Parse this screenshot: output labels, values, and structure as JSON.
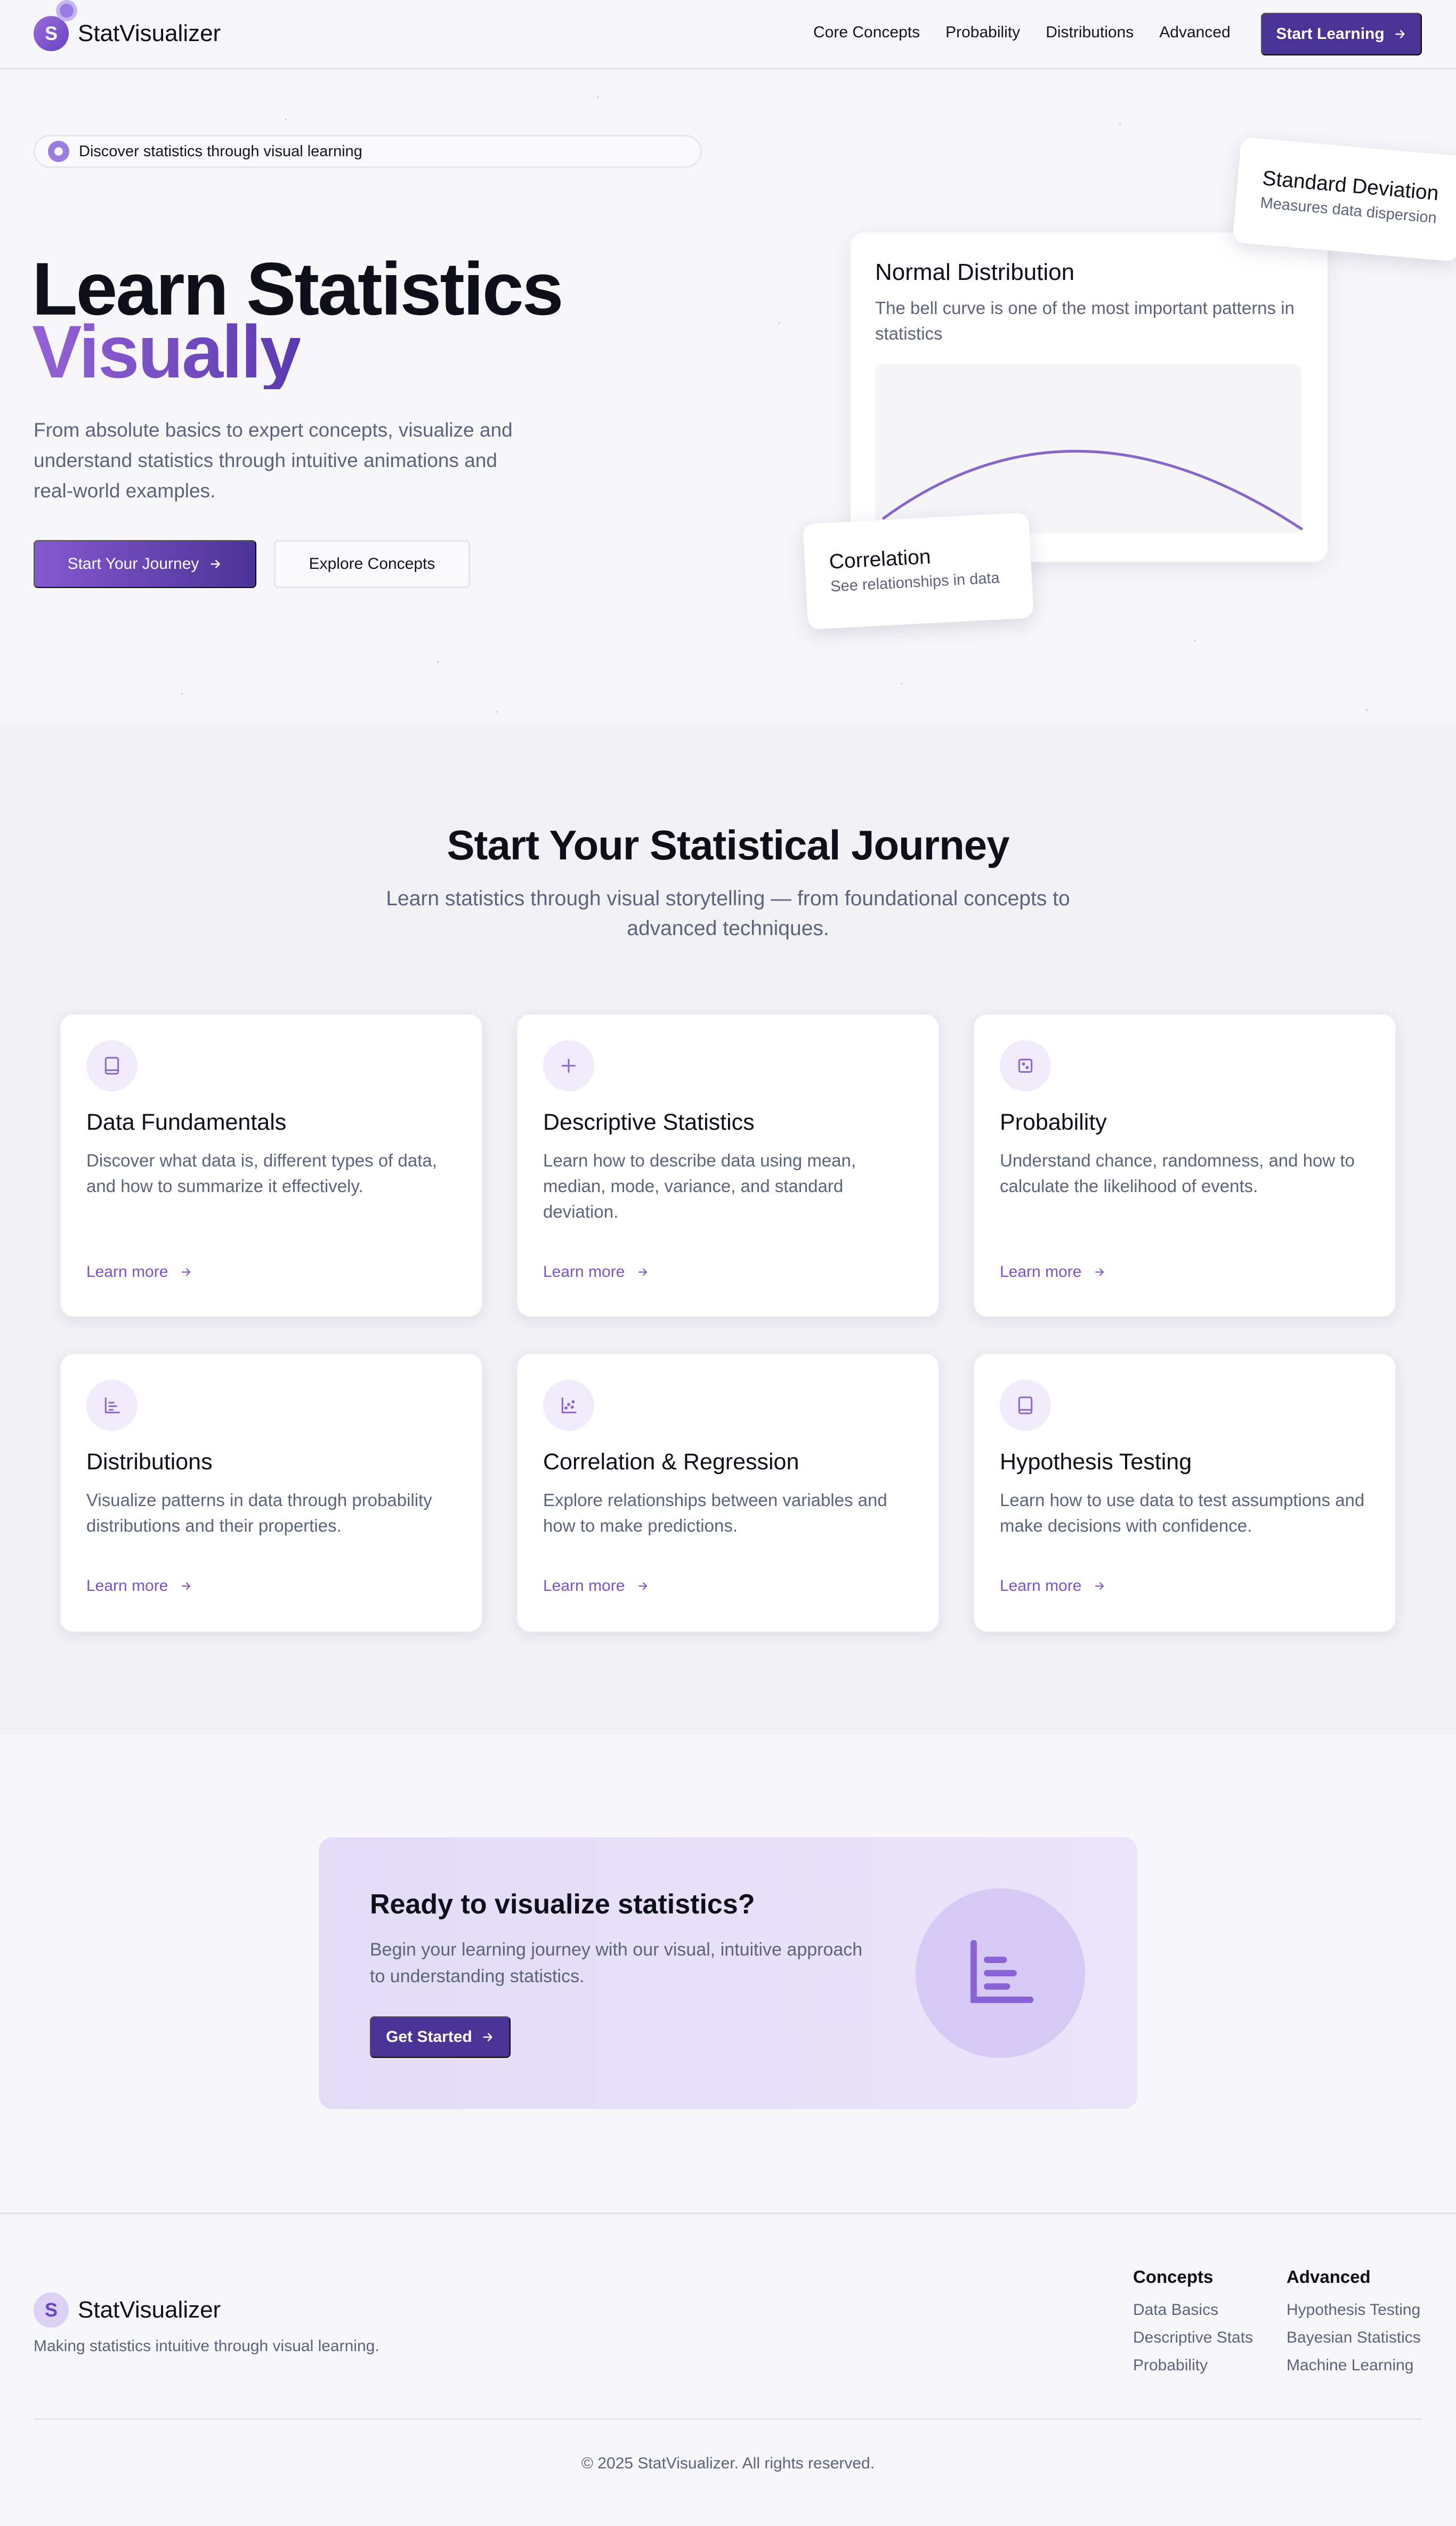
{
  "nav": {
    "logo_letter": "S",
    "brand": "StatVisualizer",
    "links": [
      "Core Concepts",
      "Probability",
      "Distributions",
      "Advanced"
    ],
    "cta_label": "Start Learning"
  },
  "hero": {
    "pill_text": "Discover statistics through visual learning",
    "title_line1": "Learn Statistics",
    "title_line2": "Visually",
    "paragraph": "From absolute basics to expert concepts, visualize and understand statistics through intuitive animations and real-world examples.",
    "primary_button": "Start Your Journey",
    "secondary_button": "Explore Concepts",
    "normal_card": {
      "title": "Normal Distribution",
      "description": "The bell curve is one of the most important patterns in statistics"
    },
    "correlation_card": {
      "title": "Correlation",
      "subtitle": "See relationships in data"
    },
    "std_card": {
      "title": "Standard Deviation",
      "subtitle": "Measures data dispersion"
    }
  },
  "journey": {
    "title": "Start Your Statistical Journey",
    "subtitle": "Learn statistics through visual storytelling — from foundational concepts to advanced techniques.",
    "cards": [
      {
        "icon": "book-icon",
        "title": "Data Fundamentals",
        "description": "Discover what data is, different types of data, and how to summarize it effectively.",
        "link": "Learn more"
      },
      {
        "icon": "plus-icon",
        "title": "Descriptive Statistics",
        "description": "Learn how to describe data using mean, median, mode, variance, and standard deviation.",
        "link": "Learn more"
      },
      {
        "icon": "dice-icon",
        "title": "Probability",
        "description": "Understand chance, randomness, and how to calculate the likelihood of events.",
        "link": "Learn more"
      },
      {
        "icon": "bar-chart-icon",
        "title": "Distributions",
        "description": "Visualize patterns in data through probability distributions and their properties.",
        "link": "Learn more"
      },
      {
        "icon": "scatter-plot-icon",
        "title": "Correlation & Regression",
        "description": "Explore relationships between variables and how to make predictions.",
        "link": "Learn more"
      },
      {
        "icon": "book-icon",
        "title": "Hypothesis Testing",
        "description": "Learn how to use data to test assumptions and make decisions with confidence.",
        "link": "Learn more"
      }
    ]
  },
  "cta": {
    "title": "Ready to visualize statistics?",
    "description": "Begin your learning journey with our visual, intuitive approach to understanding statistics.",
    "button": "Get Started"
  },
  "footer": {
    "logo_letter": "S",
    "brand": "StatVisualizer",
    "tagline": "Making statistics intuitive through visual learning.",
    "concepts": {
      "heading": "Concepts",
      "items": [
        "Data Basics",
        "Descriptive Stats",
        "Probability"
      ]
    },
    "advanced": {
      "heading": "Advanced",
      "items": [
        "Hypothesis Testing",
        "Bayesian Statistics",
        "Machine Learning"
      ]
    },
    "copyright": "© 2025 StatVisualizer. All rights reserved."
  },
  "colors": {
    "brand_primary": "#4b3396",
    "brand_accent": "#8658d1",
    "text_muted": "#5d637a"
  }
}
